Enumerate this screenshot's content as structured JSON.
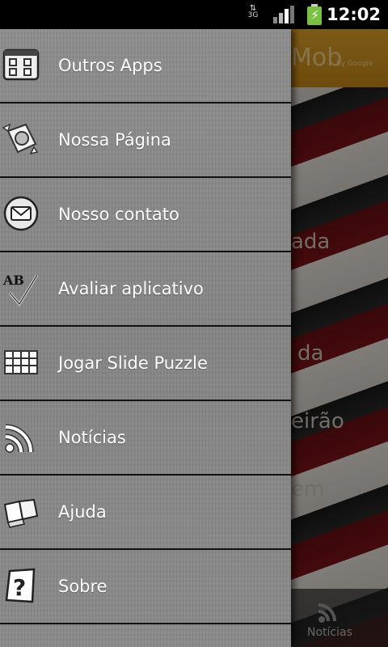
{
  "status_bar": {
    "network": "3G",
    "time": "12:02"
  },
  "drawer": {
    "items": [
      {
        "label": "Outros Apps",
        "icon": "apps-icon"
      },
      {
        "label": "Nossa Página",
        "icon": "web-page-icon"
      },
      {
        "label": "Nosso contato",
        "icon": "mail-icon"
      },
      {
        "label": "Avaliar aplicativo",
        "icon": "rate-check-icon"
      },
      {
        "label": "Jogar Slide Puzzle",
        "icon": "grid-puzzle-icon"
      },
      {
        "label": "Notícias",
        "icon": "rss-icon"
      },
      {
        "label": "Ajuda",
        "icon": "book-icon"
      },
      {
        "label": "Sobre",
        "icon": "help-question-icon"
      }
    ]
  },
  "background": {
    "ad_text": "Mob",
    "ad_by": "by Google",
    "text_lines": [
      "ada",
      "da",
      "eirão",
      "em"
    ],
    "tab_label": "Notícias"
  }
}
